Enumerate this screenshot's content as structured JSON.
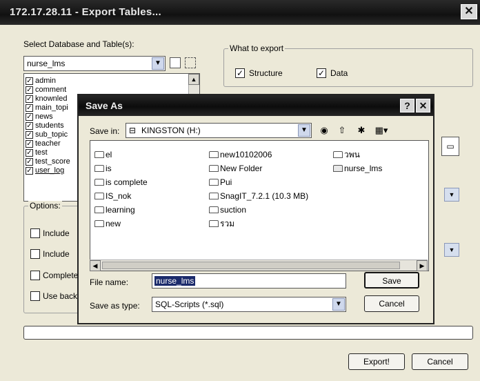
{
  "window": {
    "title": "172.17.28.11 - Export Tables...",
    "close_glyph": "✕"
  },
  "export": {
    "select_label": "Select Database and Table(s):",
    "database_value": "nurse_lms",
    "tables": [
      {
        "name": "admin",
        "checked": true
      },
      {
        "name": "comment",
        "checked": true
      },
      {
        "name": "knownled",
        "checked": true
      },
      {
        "name": "main_topi",
        "checked": true
      },
      {
        "name": "news",
        "checked": true
      },
      {
        "name": "students",
        "checked": true
      },
      {
        "name": "sub_topic",
        "checked": true
      },
      {
        "name": "teacher",
        "checked": true
      },
      {
        "name": "test",
        "checked": true
      },
      {
        "name": "test_score",
        "checked": true
      },
      {
        "name": "user_log",
        "checked": true
      }
    ],
    "what_to_export_label": "What to export",
    "structure_label": "Structure",
    "structure_checked": true,
    "data_label": "Data",
    "data_checked": true,
    "options_label": "Options:",
    "options": [
      "Include",
      "Include",
      "Complete",
      "Use back"
    ],
    "progress": 0,
    "export_button": "Export!",
    "cancel_button": "Cancel"
  },
  "save_as": {
    "title": "Save As",
    "help_glyph": "?",
    "close_glyph": "✕",
    "save_in_label": "Save in:",
    "save_in_value": "KINGSTON (H:)",
    "files": [
      {
        "name": "el",
        "type": "folder"
      },
      {
        "name": "is",
        "type": "folder"
      },
      {
        "name": "is complete",
        "type": "folder"
      },
      {
        "name": "IS_nok",
        "type": "folder"
      },
      {
        "name": "learning",
        "type": "folder"
      },
      {
        "name": "new",
        "type": "folder"
      },
      {
        "name": "new10102006",
        "type": "folder"
      },
      {
        "name": "New Folder",
        "type": "folder"
      },
      {
        "name": "Pui",
        "type": "folder"
      },
      {
        "name": "SnagIT_7.2.1 (10.3 MB)",
        "type": "folder"
      },
      {
        "name": "suction",
        "type": "folder"
      },
      {
        "name": "รวม",
        "type": "folder"
      },
      {
        "name": "วพน",
        "type": "folder"
      },
      {
        "name": "nurse_lms",
        "type": "file"
      }
    ],
    "file_name_label": "File name:",
    "file_name_value": "nurse_lms",
    "save_as_type_label": "Save as type:",
    "save_as_type_value": "SQL-Scripts (*.sql)",
    "save_button": "Save",
    "cancel_button": "Cancel"
  }
}
